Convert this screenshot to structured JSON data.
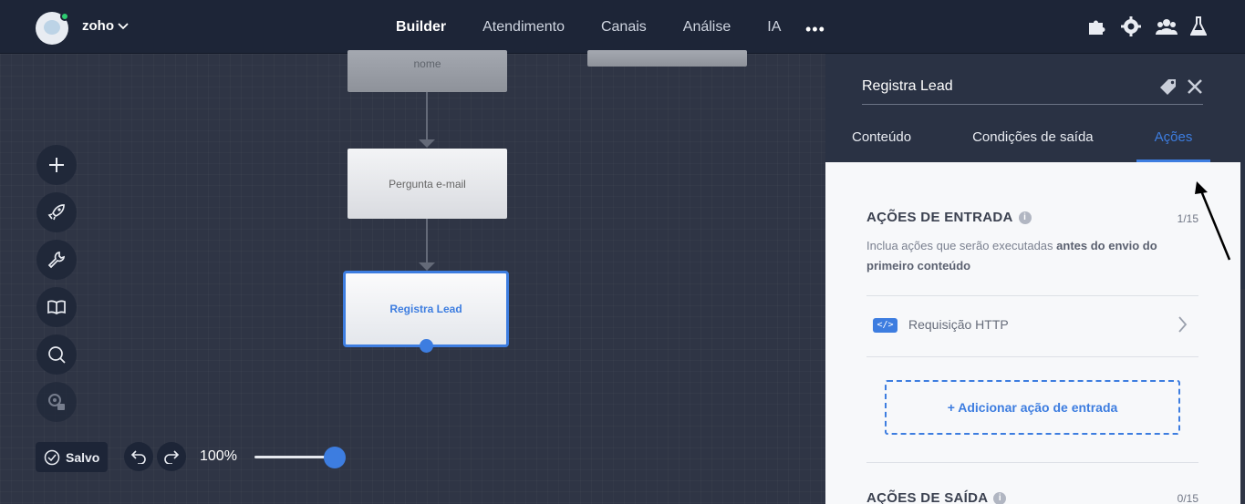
{
  "topbar": {
    "org_name": "zoho",
    "nav": [
      {
        "label": "Builder",
        "active": true
      },
      {
        "label": "Atendimento"
      },
      {
        "label": "Canais"
      },
      {
        "label": "Análise"
      },
      {
        "label": "IA"
      }
    ],
    "more_label": "•••",
    "icons": [
      "puzzle-icon",
      "gear-icon",
      "users-icon",
      "flask-icon"
    ],
    "accent": "#3d7de0"
  },
  "canvas": {
    "nodes": {
      "top_label": "nome",
      "email_label": "Pergunta e-mail",
      "selected_label": "Registra Lead"
    },
    "tools": [
      "plus-icon",
      "rocket-icon",
      "wrench-icon",
      "book-icon",
      "search-icon",
      "settings-lock-icon"
    ],
    "saved_label": "Salvo",
    "zoom_label": "100%",
    "zoom_level": 1.0
  },
  "panel": {
    "title": "Registra Lead",
    "tabs": [
      {
        "label": "Conteúdo"
      },
      {
        "label": "Condições de saída"
      },
      {
        "label": "Ações",
        "active": true
      }
    ],
    "entry_section": {
      "title": "AÇÕES DE ENTRADA",
      "count": "1/15",
      "desc_prefix": "Inclua ações que serão executadas",
      "desc_bold": "antes do envio do primeiro conteúdo",
      "items": [
        {
          "badge": "</>",
          "label": "Requisição HTTP"
        }
      ],
      "add_label": "+ Adicionar ação de entrada"
    },
    "exit_section": {
      "title": "AÇÕES DE SAÍDA",
      "count": "0/15"
    },
    "info_glyph": "i"
  }
}
